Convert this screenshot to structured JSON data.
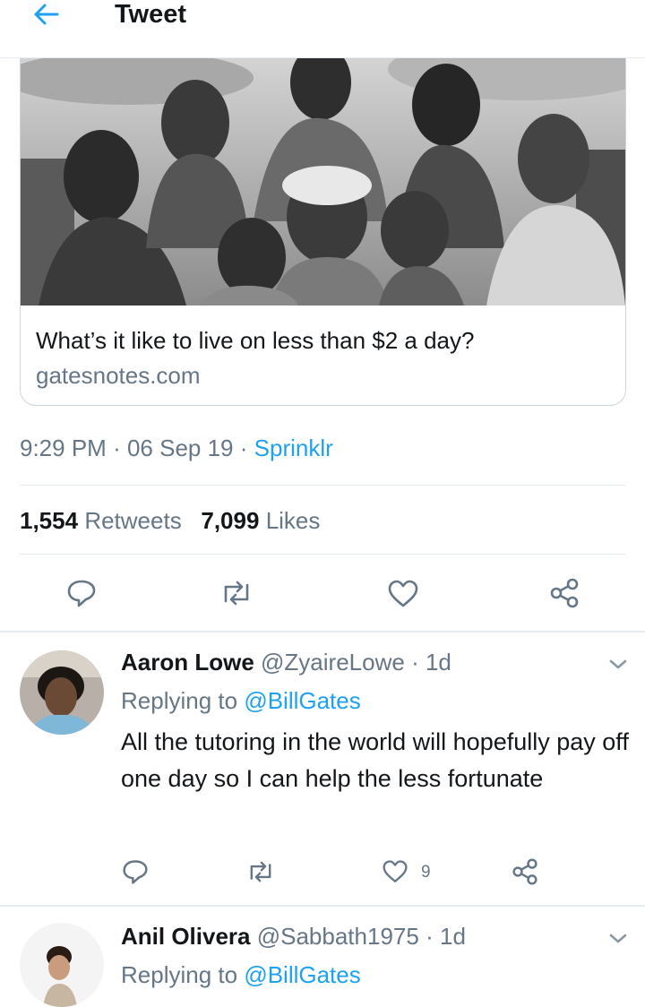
{
  "header": {
    "title": "Tweet"
  },
  "link_card": {
    "title": "What’s it like to live on less than $2 a day?",
    "domain": "gatesnotes.com"
  },
  "tweet_meta": {
    "time": "9:29 PM",
    "date": "06 Sep 19",
    "source": "Sprinklr",
    "separator": "·"
  },
  "stats": {
    "retweets_count": "1,554",
    "retweets_label": "Retweets",
    "likes_count": "7,099",
    "likes_label": "Likes"
  },
  "replies": [
    {
      "name": "Aaron Lowe",
      "handle": "@ZyaireLowe",
      "time": "1d",
      "replying_prefix": "Replying to",
      "replying_to": "@BillGates",
      "text": "All the tutoring in the world will hopefully pay off one day so I can help the less fortunate",
      "like_count": "9"
    },
    {
      "name": "Anil Olivera",
      "handle": "@Sabbath1975",
      "time": "1d",
      "replying_prefix": "Replying to",
      "replying_to": "@BillGates"
    }
  ],
  "colors": {
    "accent": "#1da1f2",
    "secondary_text": "#657786",
    "primary_text": "#14171a"
  }
}
